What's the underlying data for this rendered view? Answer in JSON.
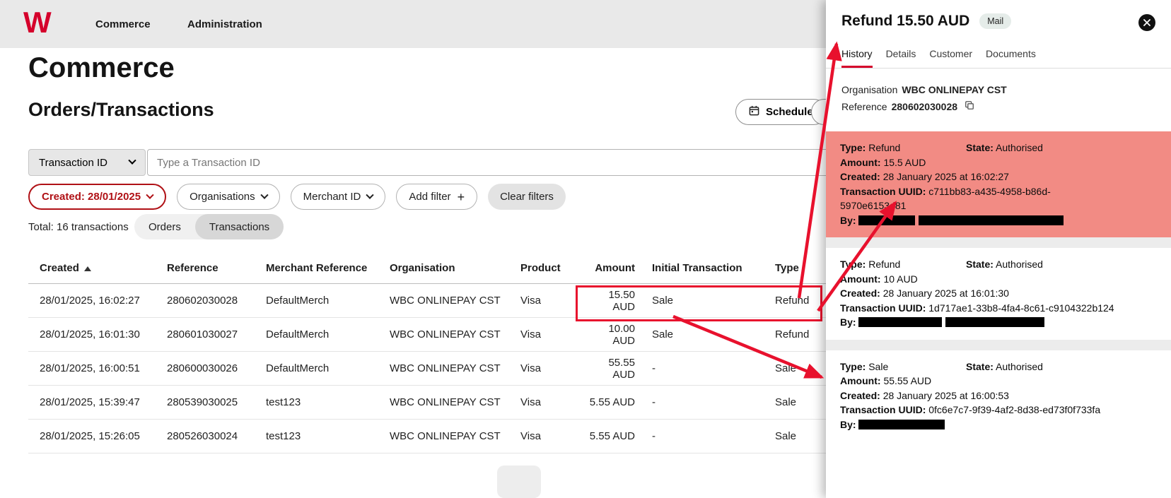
{
  "brand": {
    "logo_letter": "W",
    "color": "#d5002b"
  },
  "nav": {
    "commerce": "Commerce",
    "administration": "Administration"
  },
  "page": {
    "title": "Commerce",
    "subtitle": "Orders/Transactions"
  },
  "toolbar": {
    "schedule": "Schedule"
  },
  "search": {
    "selector": "Transaction ID",
    "placeholder": "Type a Transaction ID"
  },
  "filters": {
    "created": "Created: 28/01/2025",
    "organisations": "Organisations",
    "merchant_id": "Merchant ID",
    "add_filter": "Add filter",
    "clear_filters": "Clear filters"
  },
  "summary": {
    "total": "Total: 16 transactions"
  },
  "view_toggle": {
    "orders": "Orders",
    "transactions": "Transactions"
  },
  "table": {
    "headers": {
      "created": "Created",
      "reference": "Reference",
      "merchant_reference": "Merchant Reference",
      "organisation": "Organisation",
      "product": "Product",
      "amount": "Amount",
      "initial_transaction": "Initial Transaction",
      "type": "Type"
    },
    "rows": [
      {
        "created": "28/01/2025, 16:02:27",
        "reference": "280602030028",
        "merchant_reference": "DefaultMerch",
        "organisation": "WBC ONLINEPAY CST",
        "product": "Visa",
        "amount": "15.50 AUD",
        "initial": "Sale",
        "type": "Refund"
      },
      {
        "created": "28/01/2025, 16:01:30",
        "reference": "280601030027",
        "merchant_reference": "DefaultMerch",
        "organisation": "WBC ONLINEPAY CST",
        "product": "Visa",
        "amount": "10.00 AUD",
        "initial": "Sale",
        "type": "Refund"
      },
      {
        "created": "28/01/2025, 16:00:51",
        "reference": "280600030026",
        "merchant_reference": "DefaultMerch",
        "organisation": "WBC ONLINEPAY CST",
        "product": "Visa",
        "amount": "55.55 AUD",
        "initial": "-",
        "type": "Sale"
      },
      {
        "created": "28/01/2025, 15:39:47",
        "reference": "280539030025",
        "merchant_reference": "test123",
        "organisation": "WBC ONLINEPAY CST",
        "product": "Visa",
        "amount": "5.55 AUD",
        "initial": "-",
        "type": "Sale"
      },
      {
        "created": "28/01/2025, 15:26:05",
        "reference": "280526030024",
        "merchant_reference": "test123",
        "organisation": "WBC ONLINEPAY CST",
        "product": "Visa",
        "amount": "5.55 AUD",
        "initial": "-",
        "type": "Sale"
      }
    ]
  },
  "panel": {
    "title": "Refund 15.50 AUD",
    "badge": "Mail",
    "tabs": {
      "history": "History",
      "details": "Details",
      "customer": "Customer",
      "documents": "Documents"
    },
    "organisation_label": "Organisation",
    "organisation_value": "WBC ONLINEPAY CST",
    "reference_label": "Reference",
    "reference_value": "280602030028",
    "field_labels": {
      "type": "Type:",
      "state": "State:",
      "amount": "Amount:",
      "created": "Created:",
      "uuid": "Transaction UUID:",
      "by": "By:"
    },
    "cards": [
      {
        "type": "Refund",
        "state": "Authorised",
        "amount": "15.5 AUD",
        "created": "28 January 2025 at 16:02:27",
        "uuid": "c711bb83-a435-4958-b86d-5970e6153d81"
      },
      {
        "type": "Refund",
        "state": "Authorised",
        "amount": "10 AUD",
        "created": "28 January 2025 at 16:01:30",
        "uuid": "1d717ae1-33b8-4fa4-8c61-c9104322b124"
      },
      {
        "type": "Sale",
        "state": "Authorised",
        "amount": "55.55 AUD",
        "created": "28 January 2025 at 16:00:53",
        "uuid": "0fc6e7c7-9f39-4af2-8d38-ed73f0f733fa"
      }
    ],
    "highlight_color": "#f28b84"
  },
  "annotation": {
    "color": "#e8112d"
  }
}
